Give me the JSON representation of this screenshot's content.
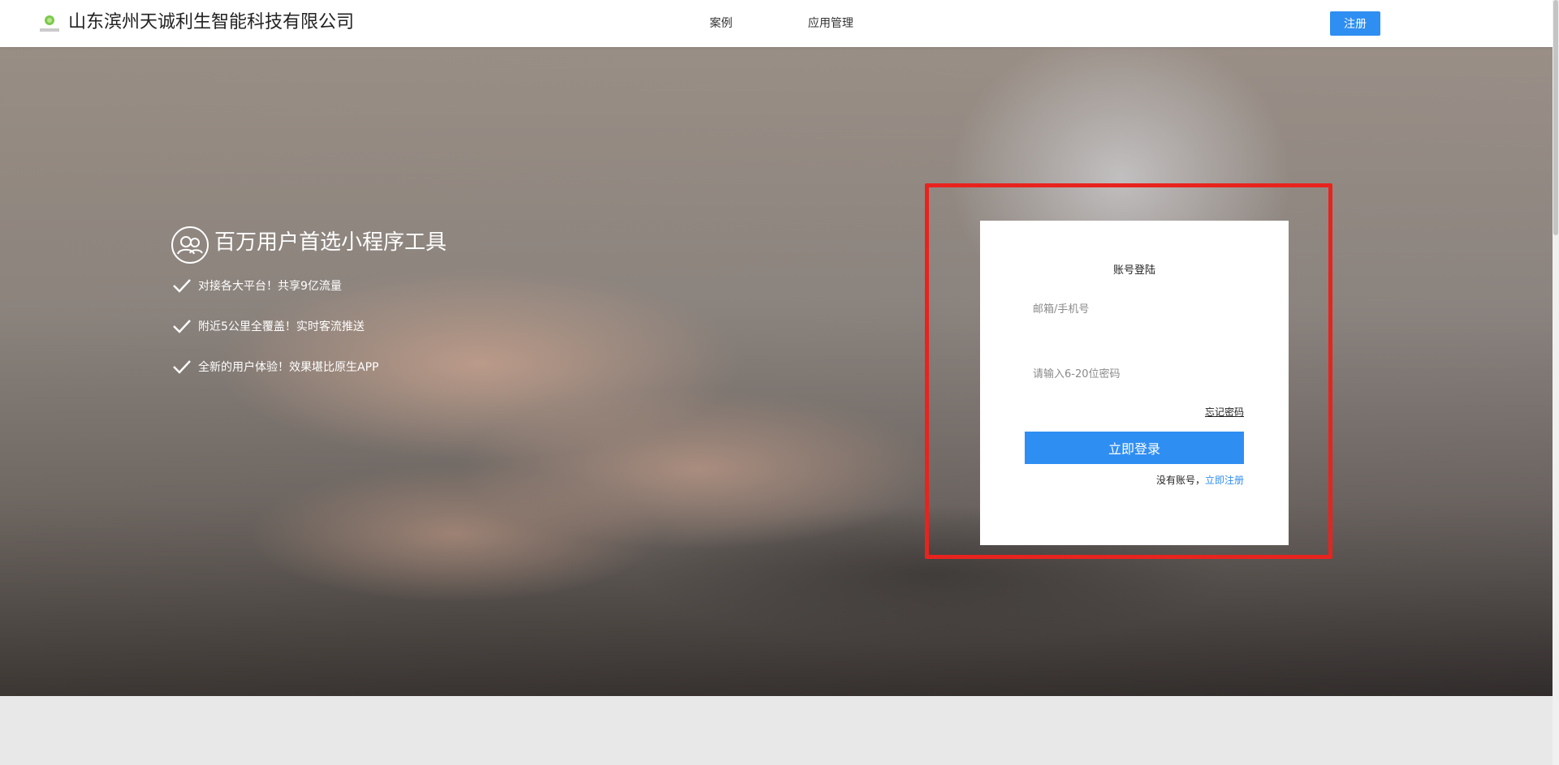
{
  "header": {
    "brand": "山东滨州天诚利生智能科技有限公司",
    "logo_text": "利生智能",
    "nav": [
      "案例",
      "应用管理"
    ],
    "register_label": "注册"
  },
  "hero": {
    "title": "百万用户首选小程序工具",
    "features": [
      "对接各大平台！共享9亿流量",
      "附近5公里全覆盖！实时客流推送",
      "全新的用户体验！效果堪比原生APP"
    ]
  },
  "login": {
    "title": "账号登陆",
    "account_placeholder": "邮箱/手机号",
    "password_placeholder": "请输入6-20位密码",
    "forgot_label": "忘记密码",
    "submit_label": "立即登录",
    "no_account_text": "没有账号，",
    "register_link": "立即注册"
  },
  "colors": {
    "accent": "#2f8ef2",
    "highlight": "#e8231e"
  },
  "icons": [
    "users-icon",
    "check-icon",
    "logo-icon"
  ]
}
